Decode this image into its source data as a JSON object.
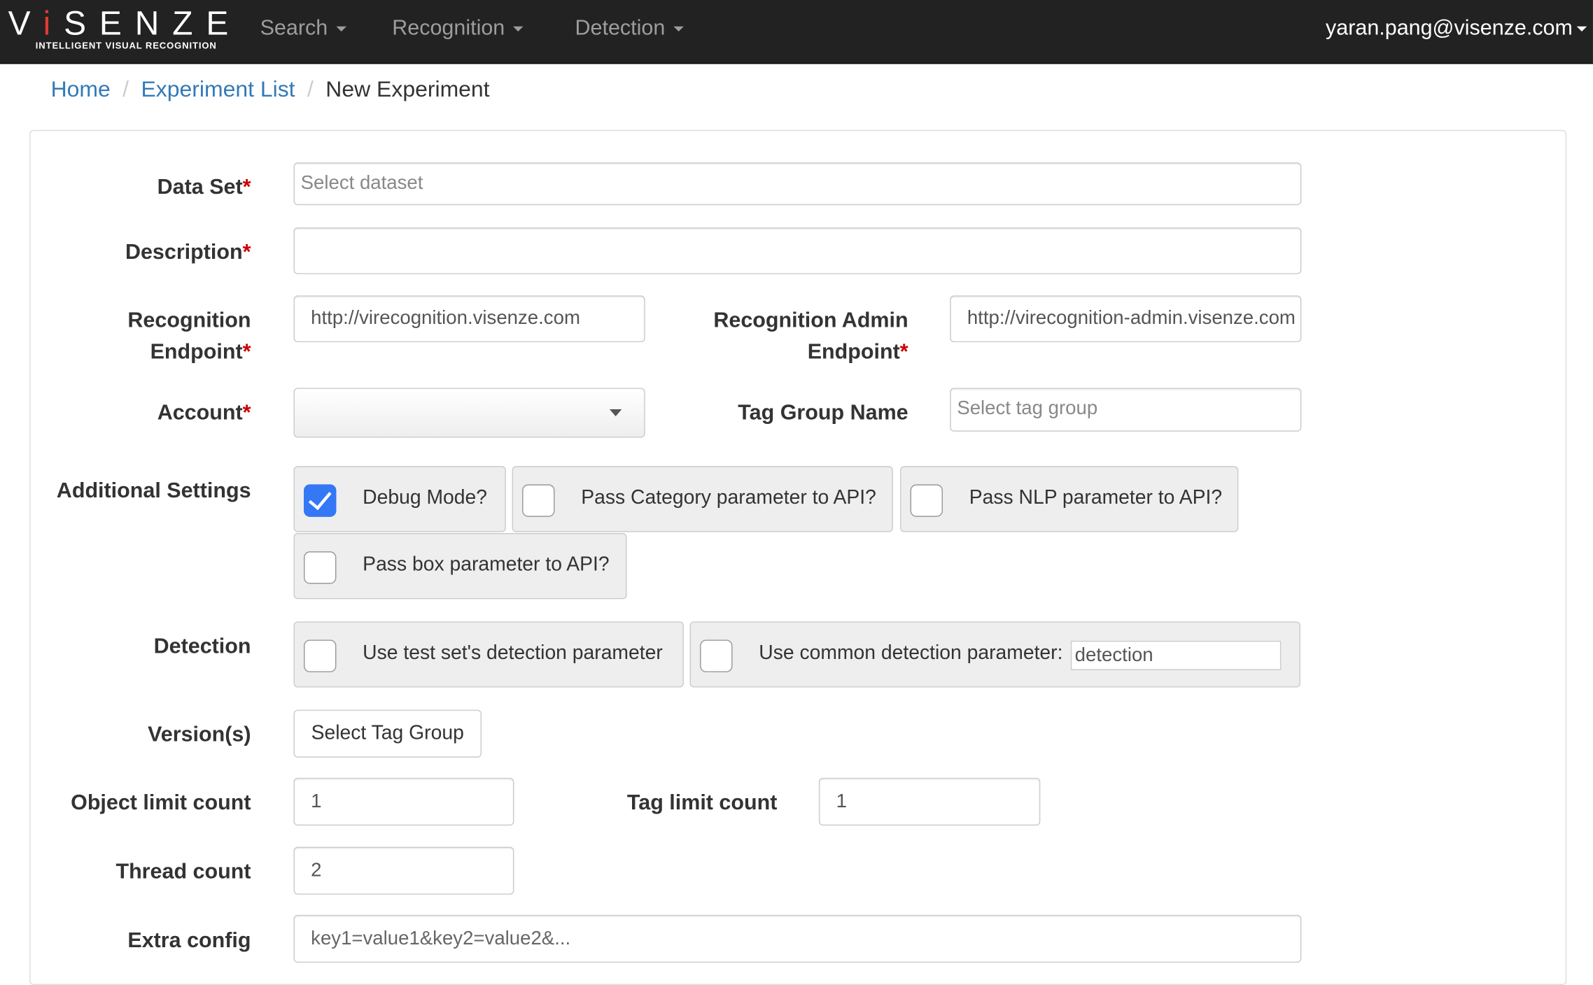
{
  "navbar": {
    "logo_word": "ViSENZE",
    "logo_tagline": "INTELLIGENT VISUAL RECOGNITION",
    "menus": [
      "Search",
      "Recognition",
      "Detection"
    ],
    "user": "yaran.pang@visenze.com"
  },
  "breadcrumb": [
    "Home",
    "Experiment List",
    "New Experiment"
  ],
  "form": {
    "dataset": {
      "label": "Data Set",
      "placeholder": "Select dataset"
    },
    "description": {
      "label": "Description",
      "value": ""
    },
    "recognition_endpoint": {
      "label_line1": "Recognition",
      "label_line2": "Endpoint",
      "value": "http://virecognition.visenze.com"
    },
    "recognition_admin_endpoint": {
      "label_line1": "Recognition Admin",
      "label_line2": "Endpoint",
      "value": "http://virecognition-admin.visenze.com"
    },
    "account": {
      "label": "Account",
      "value": ""
    },
    "tag_group_name": {
      "label": "Tag Group Name",
      "placeholder": "Select tag group"
    },
    "additional_settings": {
      "label": "Additional Settings",
      "options": [
        {
          "label": "Debug Mode?",
          "checked": true
        },
        {
          "label": "Pass Category parameter to API?",
          "checked": false
        },
        {
          "label": "Pass NLP parameter to API?",
          "checked": false
        },
        {
          "label": "Pass box parameter to API?",
          "checked": false
        }
      ]
    },
    "detection": {
      "label": "Detection",
      "use_test_set": {
        "label": "Use test set's detection parameter",
        "checked": false
      },
      "use_common": {
        "label": "Use common detection parameter:",
        "checked": false,
        "value": "detection"
      }
    },
    "versions": {
      "label": "Version(s)",
      "button": "Select Tag Group"
    },
    "object_limit": {
      "label": "Object limit count",
      "value": "1"
    },
    "tag_limit": {
      "label": "Tag limit count",
      "value": "1"
    },
    "thread_count": {
      "label": "Thread count",
      "value": "2"
    },
    "extra_config": {
      "label": "Extra config",
      "placeholder": "key1=value1&key2=value2&..."
    }
  }
}
